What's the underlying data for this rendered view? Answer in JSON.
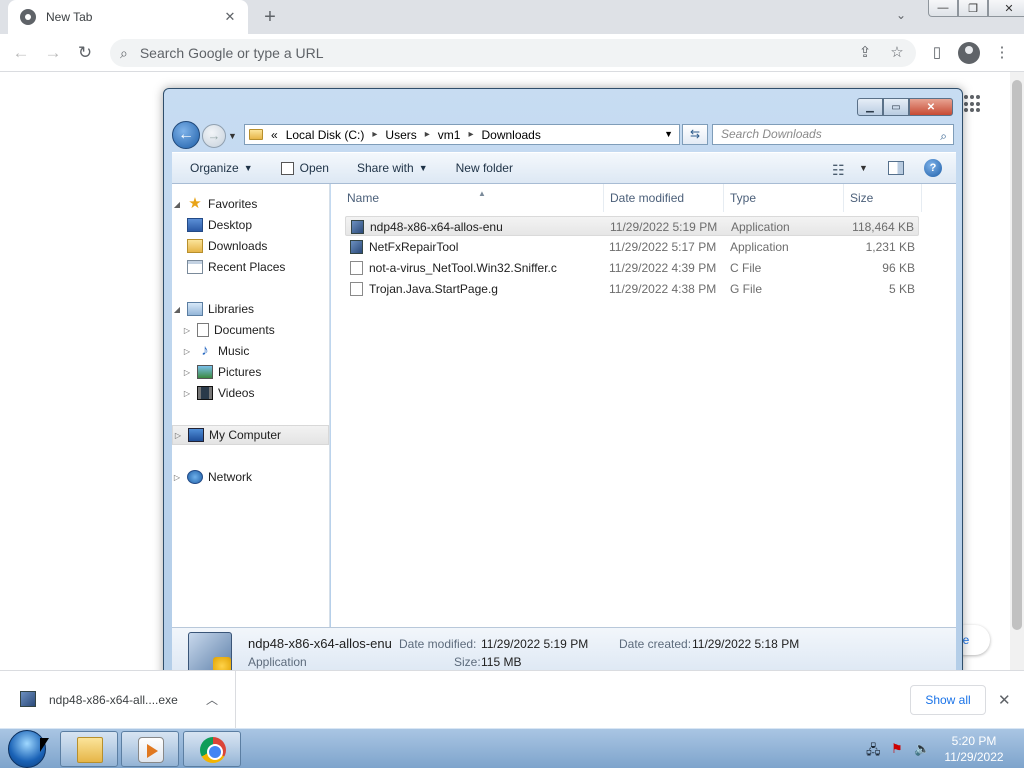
{
  "browser": {
    "tab_title": "New Tab",
    "tab_close": "✕",
    "new_tab": "+",
    "tab_search": "⌄",
    "omnibox_placeholder": "Search Google or type a URL",
    "window_min": "—",
    "window_restore": "❐",
    "window_close": "✕",
    "shortcut_partial": "ne"
  },
  "explorer": {
    "address": {
      "overflow": "«",
      "segments": [
        "Local Disk (C:)",
        "Users",
        "vm1",
        "Downloads"
      ]
    },
    "search_placeholder": "Search Downloads",
    "commands": {
      "organize": "Organize",
      "open": "Open",
      "share_with": "Share with",
      "new_folder": "New folder"
    },
    "nav": {
      "favorites": "Favorites",
      "desktop": "Desktop",
      "downloads": "Downloads",
      "recent": "Recent Places",
      "libraries": "Libraries",
      "documents": "Documents",
      "music": "Music",
      "pictures": "Pictures",
      "videos": "Videos",
      "computer": "My Computer",
      "network": "Network"
    },
    "columns": {
      "name": "Name",
      "date": "Date modified",
      "type": "Type",
      "size": "Size"
    },
    "files": [
      {
        "name": "ndp48-x86-x64-allos-enu",
        "date": "11/29/2022 5:19 PM",
        "type": "Application",
        "size": "118,464 KB"
      },
      {
        "name": "NetFxRepairTool",
        "date": "11/29/2022 5:17 PM",
        "type": "Application",
        "size": "1,231 KB"
      },
      {
        "name": "not-a-virus_NetTool.Win32.Sniffer.c",
        "date": "11/29/2022 4:39 PM",
        "type": "C File",
        "size": "96 KB"
      },
      {
        "name": "Trojan.Java.StartPage.g",
        "date": "11/29/2022 4:38 PM",
        "type": "G File",
        "size": "5 KB"
      }
    ],
    "details": {
      "name": "ndp48-x86-x64-allos-enu",
      "type": "Application",
      "modified_label": "Date modified:",
      "modified": "11/29/2022 5:19 PM",
      "created_label": "Date created:",
      "created": "11/29/2022 5:18 PM",
      "size_label": "Size:",
      "size": "115 MB"
    }
  },
  "downloads": {
    "item": "ndp48-x86-x64-all....exe",
    "show_all": "Show all",
    "close": "✕"
  },
  "taskbar": {
    "time": "5:20 PM",
    "date": "11/29/2022"
  }
}
